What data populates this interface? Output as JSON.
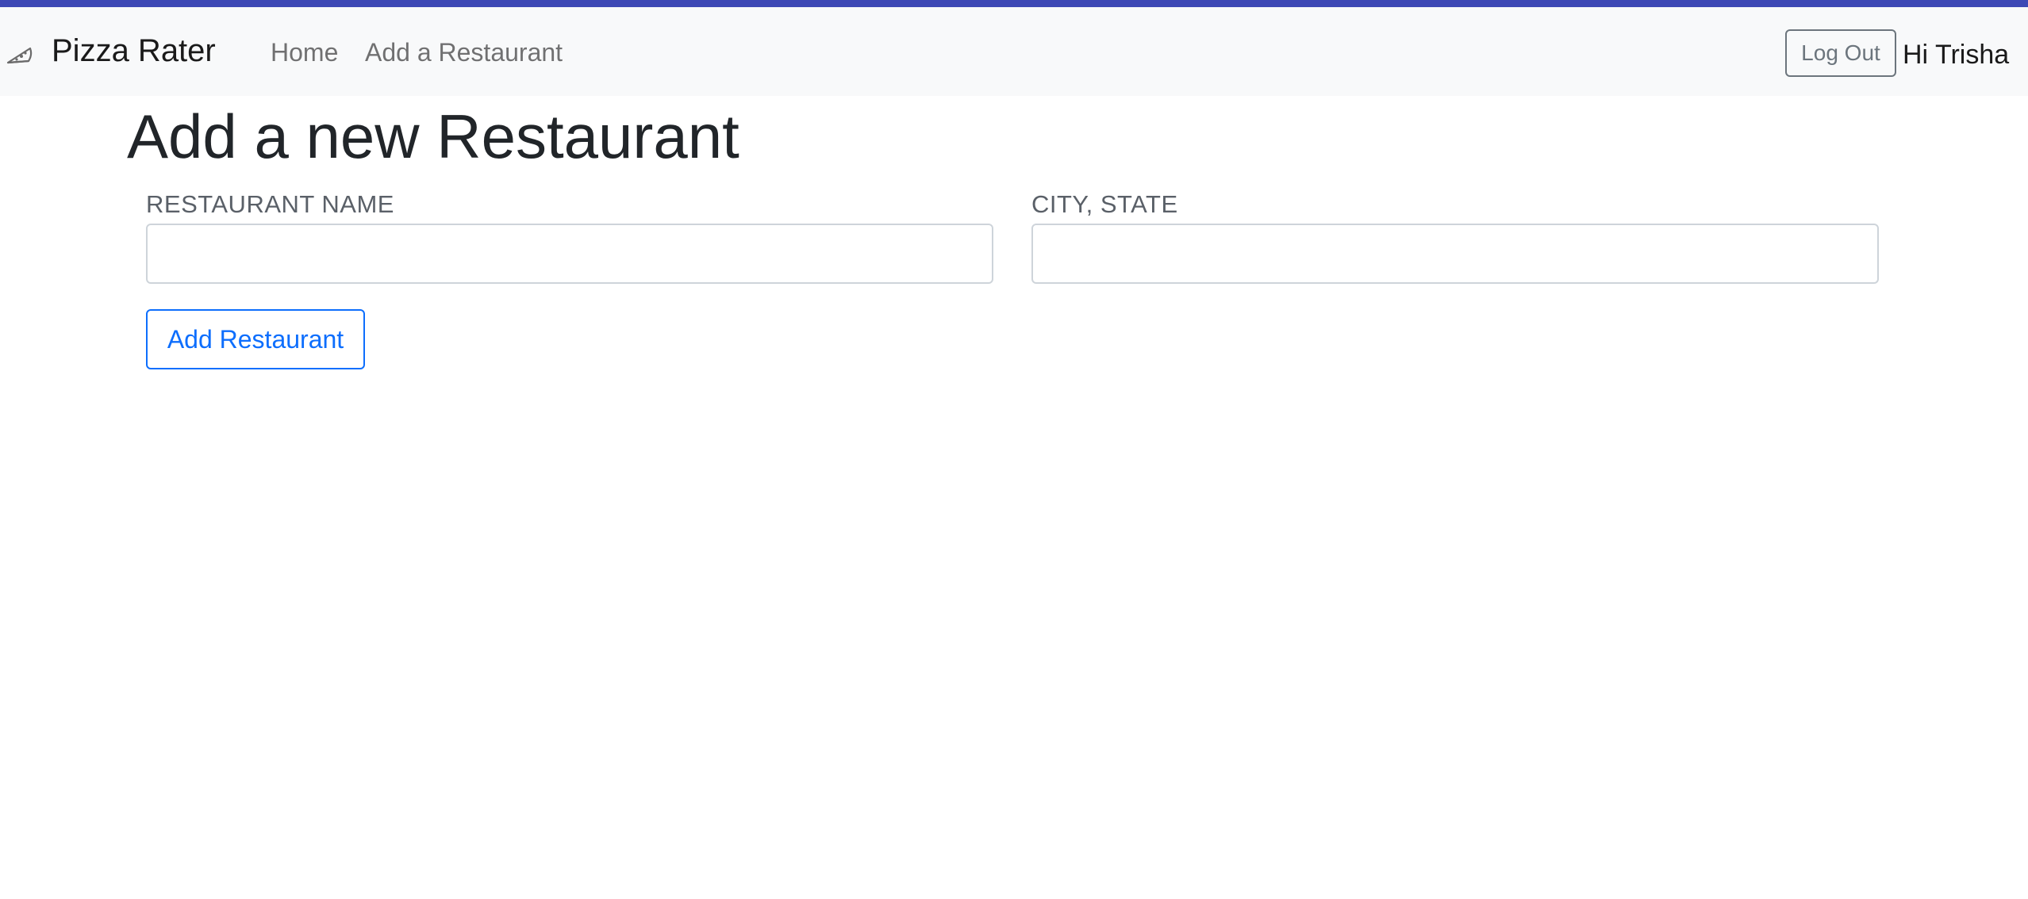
{
  "navbar": {
    "brand_icon": "pizza-slice-icon",
    "brand": "Pizza Rater",
    "links": [
      {
        "label": "Home"
      },
      {
        "label": "Add a Restaurant"
      }
    ],
    "logout_label": "Log Out",
    "greeting": "Hi Trisha"
  },
  "page": {
    "title": "Add a new Restaurant"
  },
  "form": {
    "name_label": "RESTAURANT NAME",
    "name_value": "",
    "name_placeholder": "",
    "city_label": "CITY, STATE",
    "city_value": "",
    "city_placeholder": "",
    "submit_label": "Add Restaurant"
  },
  "colors": {
    "accent_bar": "#3d48b5",
    "navbar_bg": "#f8f9fa",
    "primary": "#0d6efd",
    "secondary": "#6c757d"
  }
}
